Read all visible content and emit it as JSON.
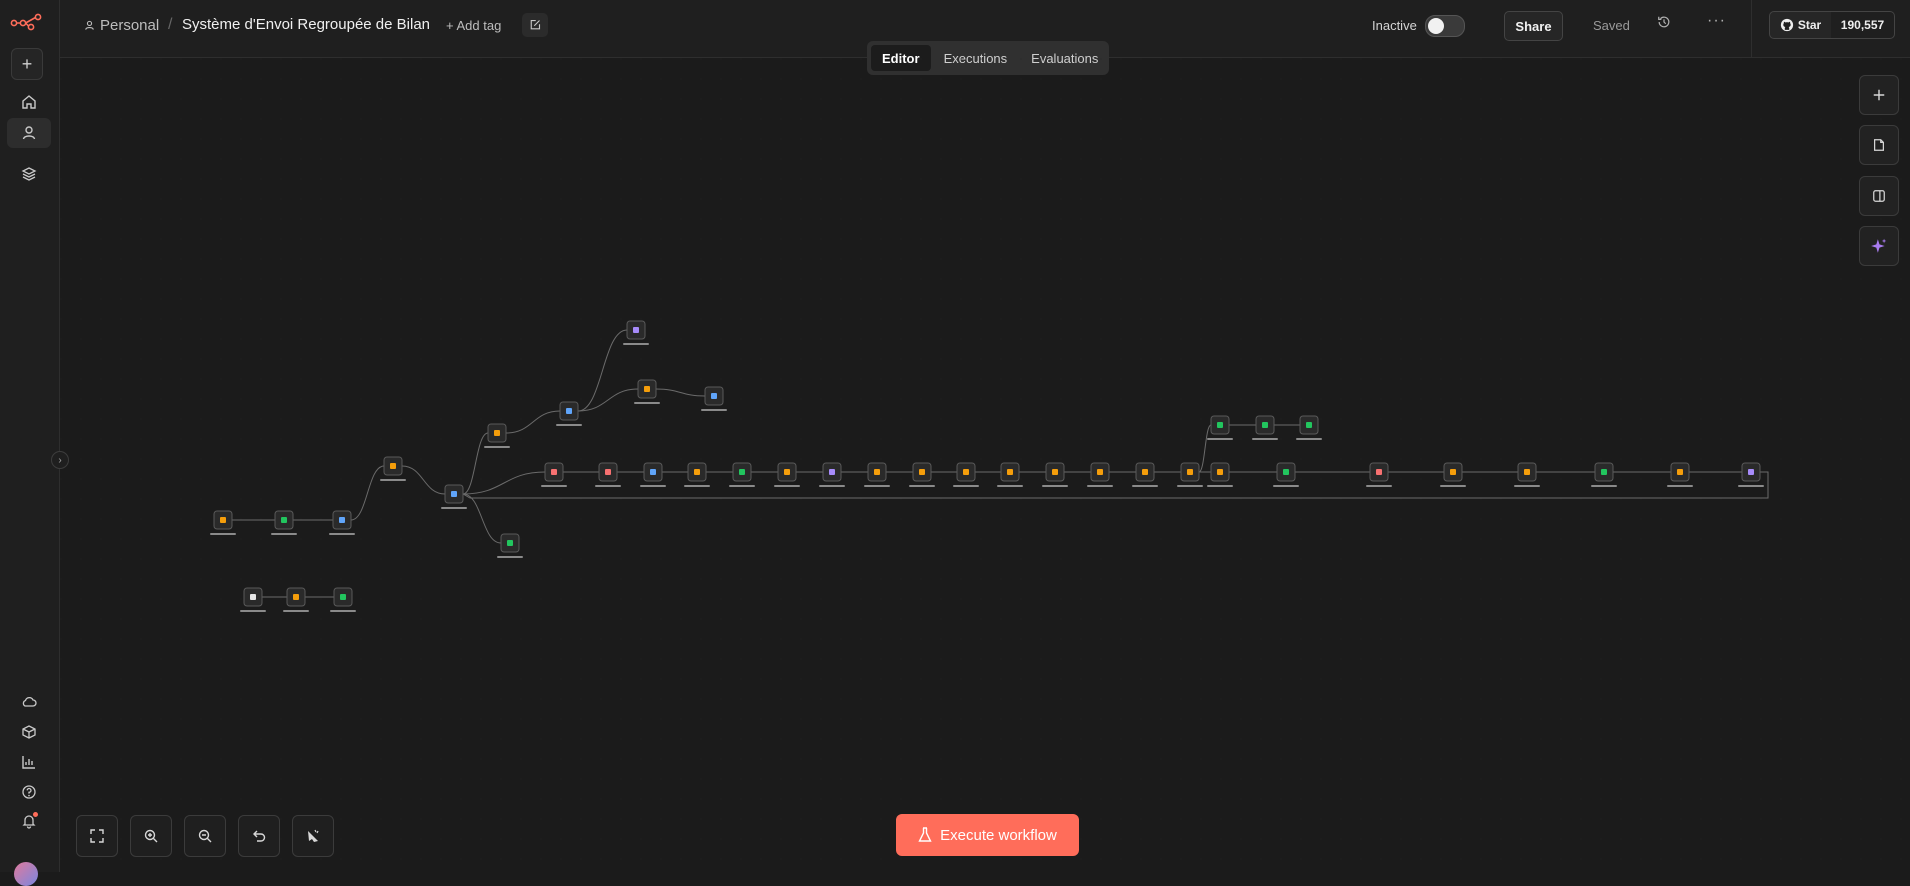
{
  "header": {
    "breadcrumb_personal": "Personal",
    "workflow_title": "Système d'Envoi Regroupée de Bilan",
    "add_tag": "+ Add tag",
    "status_label": "Inactive",
    "share": "Share",
    "saved": "Saved",
    "github_star": "Star",
    "github_count": "190,557"
  },
  "tabs": [
    "Editor",
    "Executions",
    "Evaluations"
  ],
  "execute_button": "Execute workflow",
  "icons": {
    "logo": "n8n-logo-icon",
    "plus": "plus-icon",
    "home": "home-icon",
    "user": "user-icon",
    "layers": "layers-icon",
    "cloud": "cloud-icon",
    "templates": "box-icon",
    "insights": "chart-icon",
    "help": "help-icon",
    "notifications": "bell-icon"
  },
  "colors": {
    "accent": "#ff6d5a",
    "node_bg": "#2a2a2a",
    "node_border": "#5a5a5a",
    "connection": "#6b6b6b"
  }
}
